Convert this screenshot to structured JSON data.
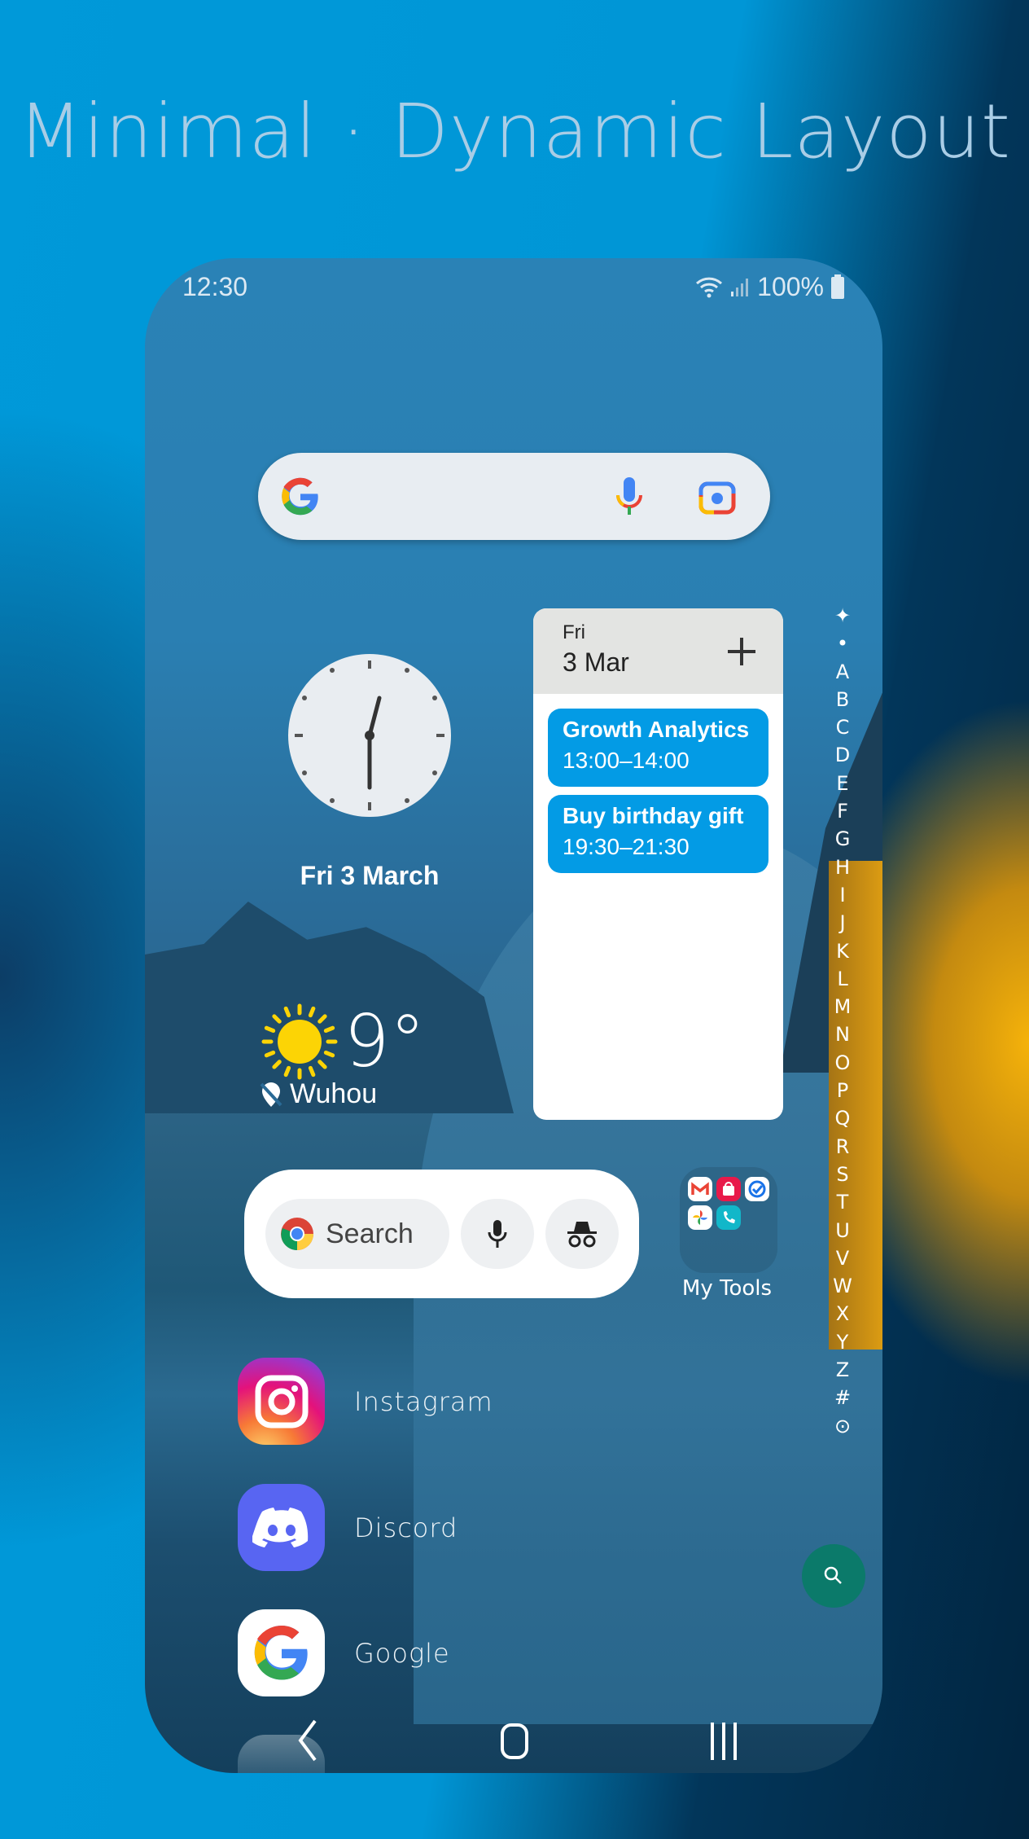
{
  "banner": {
    "title": "Minimal · Dynamic Layout"
  },
  "status_bar": {
    "time": "12:30",
    "battery": "100%",
    "icons": [
      "wifi-icon",
      "signal-icon",
      "battery-icon"
    ]
  },
  "google_bar": {
    "icons": [
      "google-logo",
      "mic-icon",
      "lens-icon"
    ]
  },
  "clock_widget": {
    "time": "12:30",
    "date": "Fri 3 March"
  },
  "calendar_widget": {
    "weekday": "Fri",
    "date": "3 Mar",
    "add_icon": "plus-icon",
    "events": [
      {
        "title": "Growth Analytics",
        "time": "13:00–14:00"
      },
      {
        "title": "Buy birthday gift",
        "time": "19:30–21:30"
      }
    ],
    "event_color": "#039be5"
  },
  "alphabet_index": [
    "✦",
    "•",
    "A",
    "B",
    "C",
    "D",
    "E",
    "F",
    "G",
    "H",
    "I",
    "J",
    "K",
    "L",
    "M",
    "N",
    "O",
    "P",
    "Q",
    "R",
    "S",
    "T",
    "U",
    "V",
    "W",
    "X",
    "Y",
    "Z",
    "#",
    "⊙"
  ],
  "weather": {
    "temperature": "9°",
    "location": "Wuhou",
    "icon": "sun-icon"
  },
  "chrome_widget": {
    "search_label": "Search",
    "icons": [
      "chrome-icon",
      "mic-icon",
      "incognito-icon"
    ]
  },
  "folder": {
    "label": "My Tools",
    "apps": [
      "Gmail",
      "Shop",
      "Tasks",
      "Photos",
      "Phone"
    ]
  },
  "apps": [
    {
      "name": "Instagram"
    },
    {
      "name": "Discord"
    },
    {
      "name": "Google"
    }
  ],
  "fab": {
    "icon": "search-icon",
    "color": "#0b7a6a"
  },
  "nav_bar": {
    "icons": [
      "back-icon",
      "home-icon",
      "recents-icon"
    ]
  }
}
